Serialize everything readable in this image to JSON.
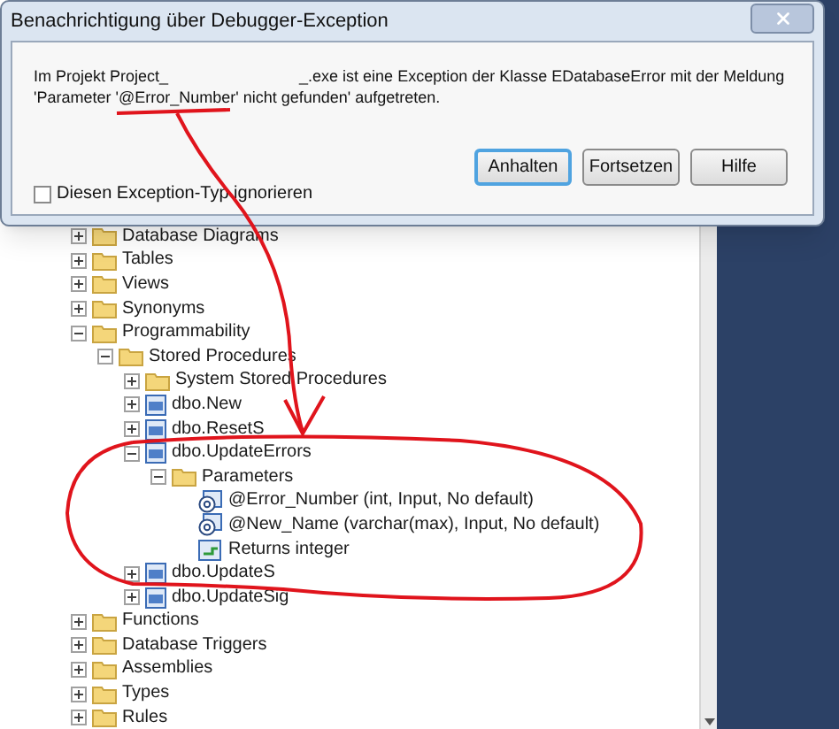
{
  "dialog": {
    "title": "Benachrichtigung über Debugger-Exception",
    "message_start": "Im Projekt Project_",
    "message_end": "_.exe ist eine Exception der Klasse EDatabaseError mit der Meldung",
    "message_line2": "'Parameter '@Error_Number' nicht gefunden' aufgetreten.",
    "checkbox": {
      "label": "Diesen Exception-Typ ignorieren",
      "checked": false
    },
    "buttons": [
      {
        "label": "Anhalten",
        "selected": true
      },
      {
        "label": "Fortsetzen",
        "selected": false
      },
      {
        "label": "Hilfe",
        "selected": false
      }
    ]
  },
  "tree": [
    {
      "label": "Database Diagrams",
      "kind": "folder",
      "expanded": false
    },
    {
      "label": "Tables",
      "kind": "folder",
      "expanded": false
    },
    {
      "label": "Views",
      "kind": "folder",
      "expanded": false
    },
    {
      "label": "Synonyms",
      "kind": "folder",
      "expanded": false
    },
    {
      "label": "Programmability",
      "kind": "folder",
      "expanded": true,
      "children": [
        {
          "label": "Stored Procedures",
          "kind": "folder",
          "expanded": true,
          "children": [
            {
              "label": "System Stored Procedures",
              "kind": "folder",
              "expanded": false
            },
            {
              "label": "dbo.New",
              "kind": "procedure",
              "expanded": false
            },
            {
              "label": "dbo.ResetS",
              "kind": "procedure",
              "expanded": false
            },
            {
              "label": "dbo.UpdateErrors",
              "kind": "procedure",
              "expanded": true,
              "children": [
                {
                  "label": "Parameters",
                  "kind": "folder",
                  "expanded": true,
                  "children": [
                    {
                      "label": "@Error_Number (int, Input, No default)",
                      "kind": "parameter"
                    },
                    {
                      "label": "@New_Name (varchar(max), Input, No default)",
                      "kind": "parameter"
                    },
                    {
                      "label": "Returns integer",
                      "kind": "return"
                    }
                  ]
                }
              ]
            },
            {
              "label": "dbo.UpdateS",
              "kind": "procedure",
              "expanded": false
            },
            {
              "label": "dbo.UpdateSig",
              "kind": "procedure",
              "expanded": false
            }
          ]
        }
      ]
    },
    {
      "label": "Functions",
      "kind": "folder",
      "expanded": false
    },
    {
      "label": "Database Triggers",
      "kind": "folder",
      "expanded": false
    },
    {
      "label": "Assemblies",
      "kind": "folder",
      "expanded": false
    },
    {
      "label": "Types",
      "kind": "folder",
      "expanded": false
    },
    {
      "label": "Rules",
      "kind": "folder",
      "expanded": false
    }
  ]
}
